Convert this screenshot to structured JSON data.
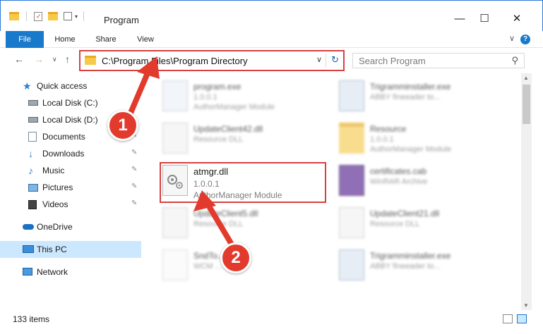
{
  "window": {
    "title": "Program",
    "minimize_glyph": "—",
    "maximize_glyph": "☐",
    "close_glyph": "✕"
  },
  "ribbon": {
    "tabs": [
      "File",
      "Home",
      "Share",
      "View"
    ],
    "expand_glyph": "∨",
    "help_glyph": "?"
  },
  "nav": {
    "back_glyph": "←",
    "forward_glyph": "→",
    "recent_glyph": "∨",
    "up_glyph": "↑",
    "address_path": "C:\\Program Files\\Program Directory",
    "address_dropdown_glyph": "∨",
    "refresh_glyph": "↻",
    "search_placeholder": "Search Program",
    "search_glyph": "⚲"
  },
  "sidebar": {
    "items": [
      {
        "label": "Quick access",
        "icon": "star-icon",
        "pinned": false
      },
      {
        "label": "Local Disk (C:)",
        "icon": "drive-icon",
        "pinned": true
      },
      {
        "label": "Local Disk (D:)",
        "icon": "drive-icon",
        "pinned": true
      },
      {
        "label": "Documents",
        "icon": "documents-icon",
        "pinned": true
      },
      {
        "label": "Downloads",
        "icon": "download-icon",
        "pinned": true
      },
      {
        "label": "Music",
        "icon": "music-icon",
        "pinned": true
      },
      {
        "label": "Pictures",
        "icon": "pictures-icon",
        "pinned": true
      },
      {
        "label": "Videos",
        "icon": "videos-icon",
        "pinned": true
      },
      {
        "label": "OneDrive",
        "icon": "cloud-icon",
        "pinned": false
      },
      {
        "label": "This PC",
        "icon": "pc-icon",
        "pinned": false,
        "selected": true
      },
      {
        "label": "Network",
        "icon": "network-icon",
        "pinned": false
      }
    ],
    "pin_glyph": "📌"
  },
  "files": [
    {
      "name": "program.exe",
      "meta1": "1.0.0.1",
      "meta2": "AuthorManager Module",
      "icon": "exe-icon"
    },
    {
      "name": "Trigramminstaller.exe",
      "meta1": "ABBY fineeader to...",
      "meta2": "",
      "icon": "installer-icon"
    },
    {
      "name": "UpdateClient42.dll",
      "meta1": "Resource DLL",
      "meta2": "",
      "icon": "dll-icon"
    },
    {
      "name": "Resource",
      "meta1": "1.0.0.1",
      "meta2": "AuthorManager Module",
      "icon": "folder-icon"
    },
    {
      "name": "atmgr.dll",
      "meta1": "1.0.0.1",
      "meta2": "AuthorManager Module",
      "icon": "dll-gear-icon"
    },
    {
      "name": "certificates.cab",
      "meta1": "WinRAR Archive",
      "meta2": "",
      "icon": "archive-icon"
    },
    {
      "name": "UpdateClient5.dll",
      "meta1": "Resource DLL",
      "meta2": "",
      "icon": "dll-icon"
    },
    {
      "name": "UpdateClient21.dll",
      "meta1": "Resource DLL",
      "meta2": "",
      "icon": "dll-icon"
    },
    {
      "name": "SndTo...secm",
      "meta1": "WCM ...",
      "meta2": "",
      "icon": "blank-icon"
    },
    {
      "name": "Trigramminstaller.exe",
      "meta1": "ABBY fineeader to...",
      "meta2": "",
      "icon": "installer-icon"
    }
  ],
  "status": {
    "item_count": "133 items"
  },
  "annotations": {
    "step1": "1",
    "step2": "2",
    "color": "#e23b2e"
  },
  "colors": {
    "accent": "#1979ca",
    "highlight_border": "#d94040",
    "selected_bg": "#cce8ff"
  }
}
